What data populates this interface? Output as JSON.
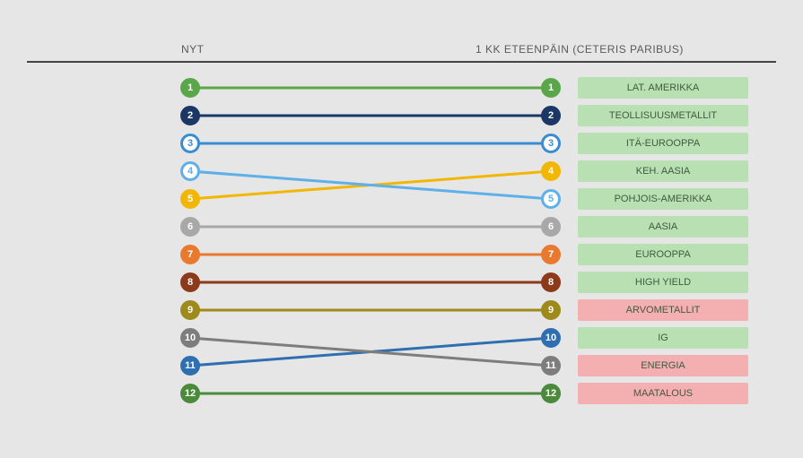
{
  "header_left": "NYT",
  "header_right": "1 KK ETEENPÄIN (CETERIS PARIBUS)",
  "chart_data": {
    "type": "slope",
    "title": "",
    "left_label": "NYT",
    "right_label": "1 KK ETEENPÄIN (CETERIS PARIBUS)",
    "ranks": [
      1,
      2,
      3,
      4,
      5,
      6,
      7,
      8,
      9,
      10,
      11,
      12
    ],
    "series": [
      {
        "name": "LAT. AMERIKKA",
        "rank_now": 1,
        "rank_fwd": 1,
        "color": "#5aa74a",
        "status": "ok"
      },
      {
        "name": "TEOLLISUUSMETALLIT",
        "rank_now": 2,
        "rank_fwd": 2,
        "color": "#1b3766",
        "status": "ok"
      },
      {
        "name": "ITÄ-EUROOPPA",
        "rank_now": 3,
        "rank_fwd": 3,
        "color": "#3a8dd0",
        "status": "ok"
      },
      {
        "name": "KEH. AASIA",
        "rank_now": 5,
        "rank_fwd": 4,
        "color": "#f2b705",
        "status": "ok"
      },
      {
        "name": "POHJOIS-AMERIKKA",
        "rank_now": 4,
        "rank_fwd": 5,
        "color": "#5fb0e8",
        "status": "ok"
      },
      {
        "name": "AASIA",
        "rank_now": 6,
        "rank_fwd": 6,
        "color": "#a8a8a8",
        "status": "ok"
      },
      {
        "name": "EUROOPPA",
        "rank_now": 7,
        "rank_fwd": 7,
        "color": "#e8792f",
        "status": "ok"
      },
      {
        "name": "HIGH YIELD",
        "rank_now": 8,
        "rank_fwd": 8,
        "color": "#8c3b1a",
        "status": "ok"
      },
      {
        "name": "ARVOMETALLIT",
        "rank_now": 9,
        "rank_fwd": 9,
        "color": "#9d8a1a",
        "status": "bad"
      },
      {
        "name": "IG",
        "rank_now": 11,
        "rank_fwd": 10,
        "color": "#2f6fb0",
        "status": "ok"
      },
      {
        "name": "ENERGIA",
        "rank_now": 10,
        "rank_fwd": 11,
        "color": "#7d7d7d",
        "status": "bad"
      },
      {
        "name": "MAATALOUS",
        "rank_now": 12,
        "rank_fwd": 12,
        "color": "#4a8a3a",
        "status": "bad"
      }
    ],
    "colors": {
      "ok": "#b9e0b3",
      "bad": "#f4b0b0"
    }
  }
}
